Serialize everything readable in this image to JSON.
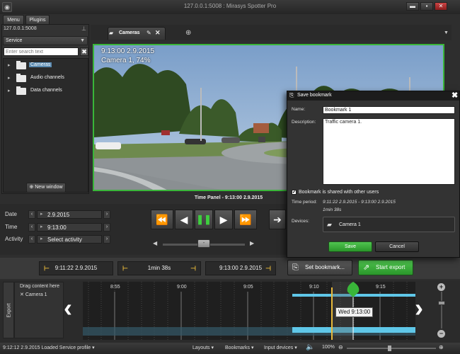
{
  "window": {
    "title": "127.0.0.1:5008 : Mirasys Spotter Pro",
    "app_icon": "app-icon",
    "buttons": [
      "minimize-icon",
      "restore-icon",
      "close-icon"
    ]
  },
  "menu_tabs": [
    "Menu",
    "Plugins"
  ],
  "left_panel": {
    "server": "127.0.0.1:5008",
    "service_label": "Service",
    "search_placeholder": "Enter search text",
    "search_clear": "✖",
    "tree": [
      "Cameras",
      "Audio channels",
      "Data channels"
    ],
    "selected": "Cameras",
    "new_window": "New window"
  },
  "camera_tab": {
    "label": "Cameras",
    "video_timestamp": "9:13:00  2.9.2015",
    "video_camera": "Camera 1, 74%"
  },
  "time_panel": {
    "header": "Time Panel - 9:13:00  2.9.2015",
    "date_label": "Date",
    "date_value": "2.9.2015",
    "time_label": "Time",
    "time_value": "9:13:00",
    "activity_label": "Activity",
    "activity_value": "Select activity",
    "speed_knob": "-"
  },
  "export": {
    "start": "9:11:22  2.9.2015",
    "duration": "1min 38s",
    "end": "9:13:00  2.9.2015",
    "set_bookmark": "Set bookmark...",
    "start_export": "Start export",
    "side_label": "Export",
    "drag_hint": "Drag content here",
    "camera": "Camera 1"
  },
  "timeline": {
    "ticks": [
      "8:55",
      "9:00",
      "9:05",
      "9:10",
      "9:15"
    ],
    "cursor_label": "Wed 9:13:00"
  },
  "status_bar": {
    "message": "9:12:12  2.9.2015 Loaded Service profile",
    "layouts": "Layouts",
    "bookmarks": "Bookmarks",
    "input_devices": "Input devices",
    "zoom": "100%"
  },
  "dialog": {
    "title": "Save bookmark",
    "name_label": "Name:",
    "name_value": "Bookmark 1",
    "desc_label": "Description:",
    "desc_value": "Traffic camera 1.",
    "shared_label": "Bookmark is shared with other users",
    "shared_checked": "✔",
    "period_label": "Time period:",
    "period_value": "9:11:22  2.9.2015 - 9:13:00  2.9.2015",
    "duration_value": "1min 38s",
    "devices_label": "Devices:",
    "device": "Camera 1",
    "save": "Save",
    "cancel": "Cancel"
  },
  "colors": {
    "accent_green": "#39b539",
    "timeline_cyan": "#5fc7e8",
    "range_bracket": "#e8b93a",
    "selection_blue": "#5a8ab0"
  }
}
